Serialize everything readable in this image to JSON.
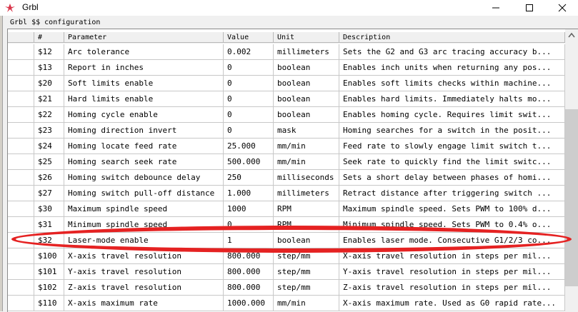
{
  "window": {
    "title": "Grbl",
    "minimize_icon": "minimize-icon",
    "maximize_icon": "maximize-icon",
    "close_icon": "close-icon"
  },
  "panel": {
    "label": "Grbl $$ configuration"
  },
  "table": {
    "columns": [
      "#",
      "Parameter",
      "Value",
      "Unit",
      "Description"
    ],
    "rows": [
      {
        "num": "$12",
        "param": "Arc tolerance",
        "value": "0.002",
        "unit": "millimeters",
        "desc": "Sets the G2 and G3 arc tracing accuracy b..."
      },
      {
        "num": "$13",
        "param": "Report in inches",
        "value": "0",
        "unit": "boolean",
        "desc": "Enables inch units when returning any pos..."
      },
      {
        "num": "$20",
        "param": "Soft limits enable",
        "value": "0",
        "unit": "boolean",
        "desc": "Enables soft limits checks within machine..."
      },
      {
        "num": "$21",
        "param": "Hard limits enable",
        "value": "0",
        "unit": "boolean",
        "desc": "Enables hard limits. Immediately halts mo..."
      },
      {
        "num": "$22",
        "param": "Homing cycle enable",
        "value": "0",
        "unit": "boolean",
        "desc": "Enables homing cycle. Requires limit swit..."
      },
      {
        "num": "$23",
        "param": "Homing direction invert",
        "value": "0",
        "unit": "mask",
        "desc": "Homing searches for a switch in the posit..."
      },
      {
        "num": "$24",
        "param": "Homing locate feed rate",
        "value": "25.000",
        "unit": "mm/min",
        "desc": "Feed rate to slowly engage limit switch t..."
      },
      {
        "num": "$25",
        "param": "Homing search seek rate",
        "value": "500.000",
        "unit": "mm/min",
        "desc": "Seek rate to quickly find the limit switc..."
      },
      {
        "num": "$26",
        "param": "Homing switch debounce delay",
        "value": "250",
        "unit": "milliseconds",
        "desc": "Sets a short delay between phases of homi..."
      },
      {
        "num": "$27",
        "param": "Homing switch pull-off distance",
        "value": "1.000",
        "unit": "millimeters",
        "desc": "Retract distance after triggering switch ..."
      },
      {
        "num": "$30",
        "param": "Maximum spindle speed",
        "value": "1000",
        "unit": "RPM",
        "desc": "Maximum spindle speed. Sets PWM to 100% d..."
      },
      {
        "num": "$31",
        "param": "Minimum spindle speed",
        "value": "0",
        "unit": "RPM",
        "desc": "Minimum spindle speed. Sets PWM to 0.4% o..."
      },
      {
        "num": "$32",
        "param": "Laser-mode enable",
        "value": "1",
        "unit": "boolean",
        "desc": "Enables laser mode. Consecutive G1/2/3 co..."
      },
      {
        "num": "$100",
        "param": "X-axis travel resolution",
        "value": "800.000",
        "unit": "step/mm",
        "desc": "X-axis travel resolution in steps per mil..."
      },
      {
        "num": "$101",
        "param": "Y-axis travel resolution",
        "value": "800.000",
        "unit": "step/mm",
        "desc": "Y-axis travel resolution in steps per mil..."
      },
      {
        "num": "$102",
        "param": "Z-axis travel resolution",
        "value": "800.000",
        "unit": "step/mm",
        "desc": "Z-axis travel resolution in steps per mil..."
      },
      {
        "num": "$110",
        "param": "X-axis maximum rate",
        "value": "1000.000",
        "unit": "mm/min",
        "desc": "X-axis maximum rate. Used as G0 rapid rate..."
      }
    ]
  },
  "annotation": {
    "color": "#e52222"
  }
}
